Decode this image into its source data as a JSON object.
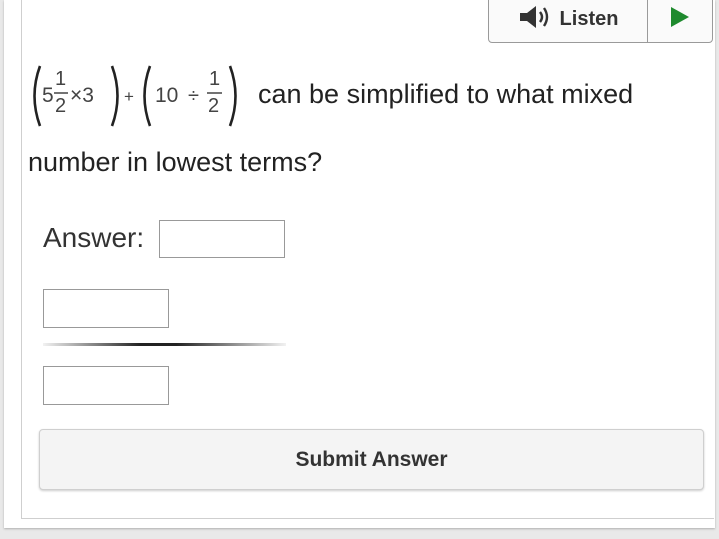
{
  "listen": {
    "label": "Listen"
  },
  "question": {
    "expression": {
      "whole": "5",
      "frac1_num": "1",
      "frac1_den": "2",
      "times": "×3",
      "plus": "+",
      "ten": "10",
      "div": "÷",
      "frac2_num": "1",
      "frac2_den": "2"
    },
    "text_part1": "can be simplified to what mixed",
    "text_part2": "number in lowest terms?"
  },
  "answer": {
    "label": "Answer:",
    "whole_value": "",
    "numerator_value": "",
    "denominator_value": ""
  },
  "submit": {
    "label": "Submit Answer"
  },
  "colors": {
    "play": "#1e8a2e",
    "speaker": "#333333"
  }
}
